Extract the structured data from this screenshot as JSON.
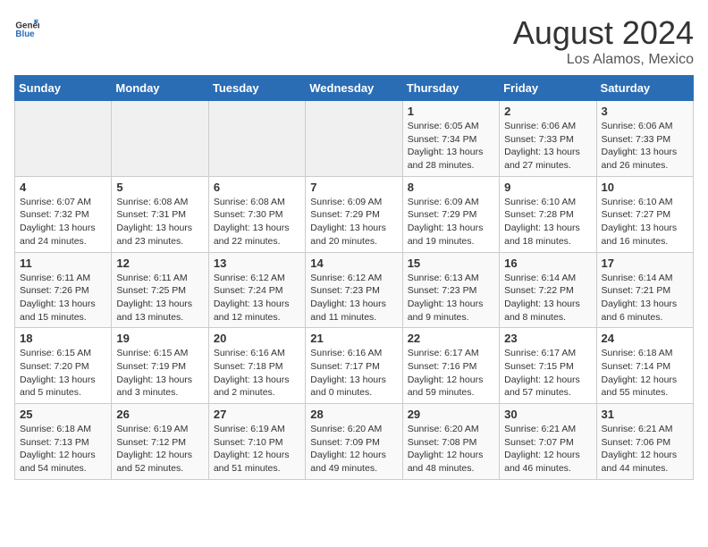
{
  "header": {
    "logo_general": "General",
    "logo_blue": "Blue",
    "title": "August 2024",
    "subtitle": "Los Alamos, Mexico"
  },
  "days_of_week": [
    "Sunday",
    "Monday",
    "Tuesday",
    "Wednesday",
    "Thursday",
    "Friday",
    "Saturday"
  ],
  "weeks": [
    [
      {
        "day": "",
        "info": ""
      },
      {
        "day": "",
        "info": ""
      },
      {
        "day": "",
        "info": ""
      },
      {
        "day": "",
        "info": ""
      },
      {
        "day": "1",
        "info": "Sunrise: 6:05 AM\nSunset: 7:34 PM\nDaylight: 13 hours\nand 28 minutes."
      },
      {
        "day": "2",
        "info": "Sunrise: 6:06 AM\nSunset: 7:33 PM\nDaylight: 13 hours\nand 27 minutes."
      },
      {
        "day": "3",
        "info": "Sunrise: 6:06 AM\nSunset: 7:33 PM\nDaylight: 13 hours\nand 26 minutes."
      }
    ],
    [
      {
        "day": "4",
        "info": "Sunrise: 6:07 AM\nSunset: 7:32 PM\nDaylight: 13 hours\nand 24 minutes."
      },
      {
        "day": "5",
        "info": "Sunrise: 6:08 AM\nSunset: 7:31 PM\nDaylight: 13 hours\nand 23 minutes."
      },
      {
        "day": "6",
        "info": "Sunrise: 6:08 AM\nSunset: 7:30 PM\nDaylight: 13 hours\nand 22 minutes."
      },
      {
        "day": "7",
        "info": "Sunrise: 6:09 AM\nSunset: 7:29 PM\nDaylight: 13 hours\nand 20 minutes."
      },
      {
        "day": "8",
        "info": "Sunrise: 6:09 AM\nSunset: 7:29 PM\nDaylight: 13 hours\nand 19 minutes."
      },
      {
        "day": "9",
        "info": "Sunrise: 6:10 AM\nSunset: 7:28 PM\nDaylight: 13 hours\nand 18 minutes."
      },
      {
        "day": "10",
        "info": "Sunrise: 6:10 AM\nSunset: 7:27 PM\nDaylight: 13 hours\nand 16 minutes."
      }
    ],
    [
      {
        "day": "11",
        "info": "Sunrise: 6:11 AM\nSunset: 7:26 PM\nDaylight: 13 hours\nand 15 minutes."
      },
      {
        "day": "12",
        "info": "Sunrise: 6:11 AM\nSunset: 7:25 PM\nDaylight: 13 hours\nand 13 minutes."
      },
      {
        "day": "13",
        "info": "Sunrise: 6:12 AM\nSunset: 7:24 PM\nDaylight: 13 hours\nand 12 minutes."
      },
      {
        "day": "14",
        "info": "Sunrise: 6:12 AM\nSunset: 7:23 PM\nDaylight: 13 hours\nand 11 minutes."
      },
      {
        "day": "15",
        "info": "Sunrise: 6:13 AM\nSunset: 7:23 PM\nDaylight: 13 hours\nand 9 minutes."
      },
      {
        "day": "16",
        "info": "Sunrise: 6:14 AM\nSunset: 7:22 PM\nDaylight: 13 hours\nand 8 minutes."
      },
      {
        "day": "17",
        "info": "Sunrise: 6:14 AM\nSunset: 7:21 PM\nDaylight: 13 hours\nand 6 minutes."
      }
    ],
    [
      {
        "day": "18",
        "info": "Sunrise: 6:15 AM\nSunset: 7:20 PM\nDaylight: 13 hours\nand 5 minutes."
      },
      {
        "day": "19",
        "info": "Sunrise: 6:15 AM\nSunset: 7:19 PM\nDaylight: 13 hours\nand 3 minutes."
      },
      {
        "day": "20",
        "info": "Sunrise: 6:16 AM\nSunset: 7:18 PM\nDaylight: 13 hours\nand 2 minutes."
      },
      {
        "day": "21",
        "info": "Sunrise: 6:16 AM\nSunset: 7:17 PM\nDaylight: 13 hours\nand 0 minutes."
      },
      {
        "day": "22",
        "info": "Sunrise: 6:17 AM\nSunset: 7:16 PM\nDaylight: 12 hours\nand 59 minutes."
      },
      {
        "day": "23",
        "info": "Sunrise: 6:17 AM\nSunset: 7:15 PM\nDaylight: 12 hours\nand 57 minutes."
      },
      {
        "day": "24",
        "info": "Sunrise: 6:18 AM\nSunset: 7:14 PM\nDaylight: 12 hours\nand 55 minutes."
      }
    ],
    [
      {
        "day": "25",
        "info": "Sunrise: 6:18 AM\nSunset: 7:13 PM\nDaylight: 12 hours\nand 54 minutes."
      },
      {
        "day": "26",
        "info": "Sunrise: 6:19 AM\nSunset: 7:12 PM\nDaylight: 12 hours\nand 52 minutes."
      },
      {
        "day": "27",
        "info": "Sunrise: 6:19 AM\nSunset: 7:10 PM\nDaylight: 12 hours\nand 51 minutes."
      },
      {
        "day": "28",
        "info": "Sunrise: 6:20 AM\nSunset: 7:09 PM\nDaylight: 12 hours\nand 49 minutes."
      },
      {
        "day": "29",
        "info": "Sunrise: 6:20 AM\nSunset: 7:08 PM\nDaylight: 12 hours\nand 48 minutes."
      },
      {
        "day": "30",
        "info": "Sunrise: 6:21 AM\nSunset: 7:07 PM\nDaylight: 12 hours\nand 46 minutes."
      },
      {
        "day": "31",
        "info": "Sunrise: 6:21 AM\nSunset: 7:06 PM\nDaylight: 12 hours\nand 44 minutes."
      }
    ]
  ]
}
